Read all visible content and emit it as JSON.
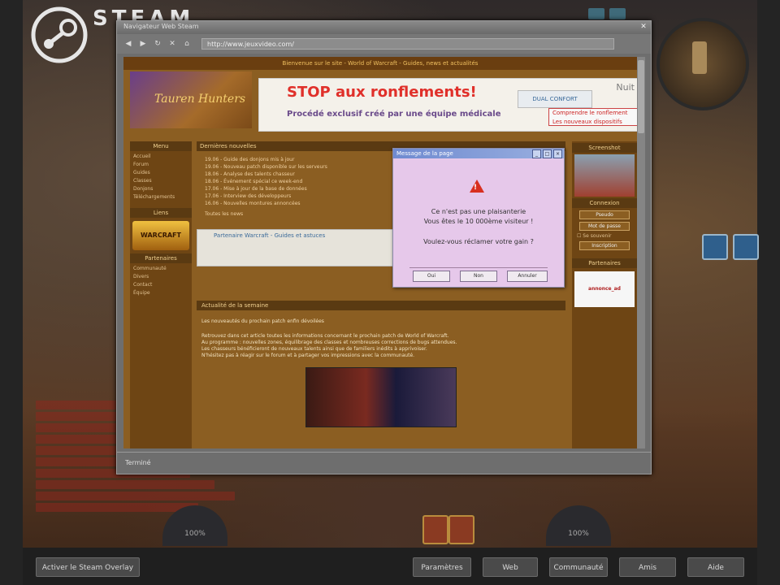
{
  "overlay": {
    "brand": "STEAM",
    "bottom_left_button": "Activer le Steam Overlay",
    "bottom_buttons": [
      "Paramètres",
      "Web",
      "Communauté",
      "Amis",
      "Aide"
    ]
  },
  "browser": {
    "title": "Navigateur Web Steam",
    "url": "http://www.jeuxvideo.com/",
    "status": "Terminé",
    "nav_icons": [
      "back-icon",
      "forward-icon",
      "reload-icon",
      "stop-icon",
      "home-icon"
    ]
  },
  "site": {
    "topbar": "Bienvenue sur le site - World of Warcraft - Guides, news et actualités",
    "logo_text": "Tauren Hunters",
    "ad": {
      "title": "STOP aux ronflements!",
      "subtitle": "Procédé exclusif créé par une équipe médicale",
      "brand": "Nuit",
      "box1": "DUAL CONFORT",
      "box2_line1": "Comprendre le ronflement",
      "box2_line2": "Les nouveaux dispositifs"
    },
    "left_nav": {
      "head": "Menu",
      "items": [
        "Accueil",
        "Forum",
        "Guides",
        "Classes",
        "Donjons",
        "Téléchargements"
      ],
      "wow_logo": "WARCRAFT",
      "wow_head": "Liens",
      "sections": [
        "Partenaires",
        "Communauté",
        "Divers",
        "Contact",
        "Équipe"
      ]
    },
    "center": {
      "head": "Dernières nouvelles",
      "news": [
        "19.06 - Guide des donjons mis à jour",
        "19.06 - Nouveau patch disponible sur les serveurs",
        "18.06 - Analyse des talents chasseur",
        "18.06 - Événement spécial ce week-end",
        "17.06 - Mise à jour de la base de données",
        "17.06 - Interview des développeurs",
        "16.06 - Nouvelles montures annoncées"
      ],
      "more": "Toutes les news",
      "partner": "Partenaire Warcraft - Guides et astuces"
    },
    "article": {
      "head": "Actualité de la semaine",
      "title": "Les nouveautés du prochain patch enfin dévoilées",
      "lines": [
        "Retrouvez dans cet article toutes les informations concernant le prochain patch de World of Warcraft.",
        "Au programme : nouvelles zones, équilibrage des classes et nombreuses corrections de bugs attendues.",
        "Les chasseurs bénéficieront de nouveaux talents ainsi que de familiers inédits à apprivoiser.",
        "N'hésitez pas à réagir sur le forum et à partager vos impressions avec la communauté."
      ]
    },
    "right_col": {
      "head1": "Screenshot",
      "head2": "Connexion",
      "login_label": "Pseudo",
      "password_label": "Mot de passe",
      "remember": "Se souvenir",
      "register": "Inscription",
      "head3": "Partenaires",
      "ad_text": "annonce_ad"
    }
  },
  "popup": {
    "title": "Message de la page",
    "ctrls": [
      "_",
      "□",
      "×"
    ],
    "message_line1": "Ce n'est pas une plaisanterie",
    "message_line2": "Vous êtes le 10 000ème visiteur !",
    "question": "Voulez-vous réclamer votre gain ?",
    "buttons": [
      "Oui",
      "Non",
      "Annuler"
    ]
  },
  "game": {
    "action_orb_left": "100%",
    "action_orb_right": "100%"
  }
}
